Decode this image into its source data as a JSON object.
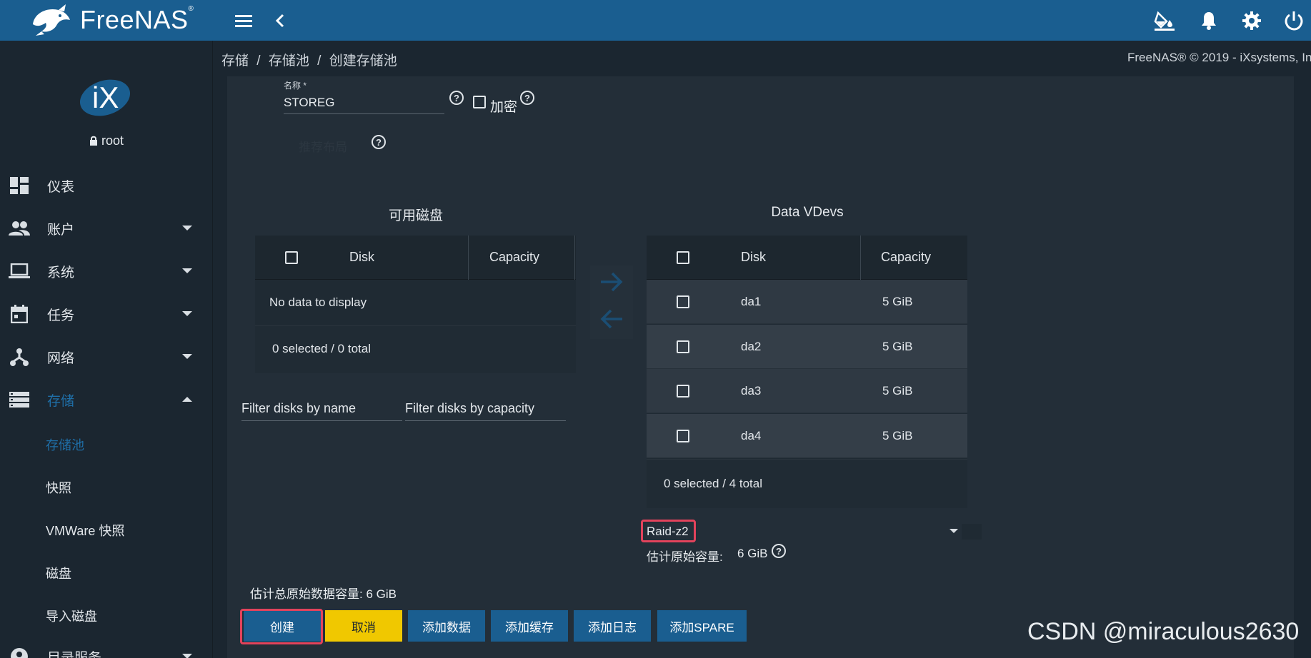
{
  "topbar": {
    "logo_text": "FreeNAS",
    "logo_reg": "®",
    "icons": [
      "menu-icon",
      "chevron-left-icon",
      "theme-bucket-icon",
      "bell-icon",
      "gear-icon",
      "power-icon"
    ]
  },
  "sidebar": {
    "user": "root",
    "items": [
      {
        "label": "仪表",
        "icon": "dashboard-icon"
      },
      {
        "label": "账户",
        "icon": "people-icon"
      },
      {
        "label": "系统",
        "icon": "laptop-icon"
      },
      {
        "label": "任务",
        "icon": "calendar-icon"
      },
      {
        "label": "网络",
        "icon": "network-icon"
      },
      {
        "label": "存储",
        "icon": "storage-icon"
      },
      {
        "label": "目录服务",
        "icon": "directory-icon"
      }
    ],
    "sub_items": [
      "存储池",
      "快照",
      "VMWare 快照",
      "磁盘",
      "导入磁盘"
    ]
  },
  "breadcrumb": {
    "items": [
      "存储",
      "存储池",
      "创建存储池"
    ],
    "separator": "/"
  },
  "copyright": "FreeNAS® © 2019 - iXsystems, In",
  "form": {
    "name_label": "名称 *",
    "name_value": "STOREG",
    "encrypt_label": "加密",
    "faded_label": "推荐布局"
  },
  "available": {
    "title": "可用磁盘",
    "col_disk": "Disk",
    "col_capacity": "Capacity",
    "empty": "No data to display",
    "footer": "0 selected / 0 total",
    "filter_name": "Filter disks by name",
    "filter_capacity": "Filter disks by capacity"
  },
  "vdevs": {
    "title": "Data VDevs",
    "col_disk": "Disk",
    "col_capacity": "Capacity",
    "rows": [
      {
        "disk": "da1",
        "capacity": "5 GiB"
      },
      {
        "disk": "da2",
        "capacity": "5 GiB"
      },
      {
        "disk": "da3",
        "capacity": "5 GiB"
      },
      {
        "disk": "da4",
        "capacity": "5 GiB"
      }
    ],
    "footer": "0 selected / 4 total",
    "layout_value": "Raid-z2",
    "estimate_label": "估计原始容量:",
    "estimate_value": "6 GiB"
  },
  "total_estimate": "估计总原始数据容量: 6 GiB",
  "buttons": {
    "create": "创建",
    "cancel": "取消",
    "add_data": "添加数据",
    "add_cache": "添加缓存",
    "add_log": "添加日志",
    "add_spare": "添加SPARE"
  },
  "watermark": "CSDN @miraculous2630",
  "colors": {
    "topbar": "#1a5e90",
    "background": "#1b2630",
    "card": "#232e38",
    "accent": "#1f6fa8",
    "highlight": "#e3435c",
    "cancel_button": "#f0c800"
  }
}
